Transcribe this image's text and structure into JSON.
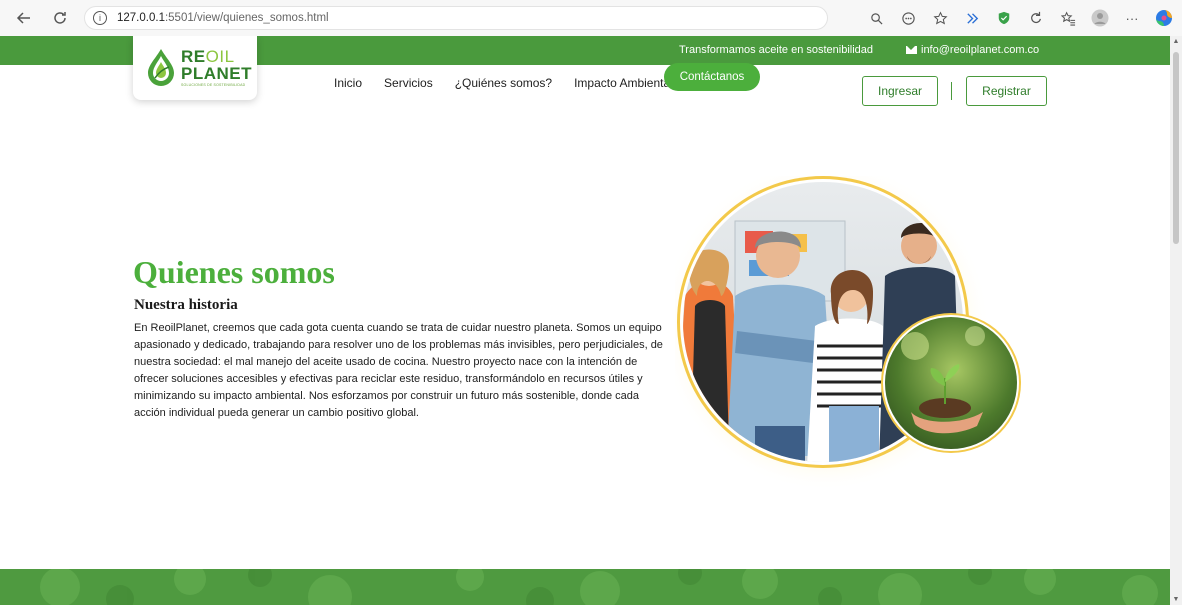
{
  "browser": {
    "url_host": "127.0.0.1",
    "url_path": ":5501/view/quienes_somos.html",
    "icons": [
      "back-icon",
      "reload-icon",
      "info-icon",
      "zoom-icon",
      "reader-icon",
      "favorite-icon",
      "copilot-icon",
      "extension-shield-icon",
      "refresh-extension-icon",
      "favorites-icon",
      "profile-icon",
      "more-icon",
      "edge-icon"
    ]
  },
  "topbar": {
    "tagline": "Transformamos aceite en sostenibilidad",
    "email": "info@reoilplanet.com.co"
  },
  "logo": {
    "word_re": "RE",
    "word_oil": "OIL",
    "word_planet": "PLANET",
    "tagline": "SOLUCIONES DE SOSTENIBILIDAD"
  },
  "nav": {
    "items": [
      "Inicio",
      "Servicios",
      "¿Quiénes somos?",
      "Impacto Ambiental"
    ],
    "cta": "Contáctanos"
  },
  "auth": {
    "login": "Ingresar",
    "register": "Registrar"
  },
  "hero": {
    "title": "Quienes somos",
    "subtitle": "Nuestra historia",
    "text": "En ReoilPlanet, creemos que cada gota cuenta cuando se trata de cuidar nuestro planeta. Somos un equipo apasionado y dedicado, trabajando para resolver uno de los problemas más invisibles, pero perjudiciales, de nuestra sociedad: el mal manejo del aceite usado de cocina. Nuestro proyecto nace con la intención de ofrecer soluciones accesibles y efectivas para reciclar este residuo, transformándolo en recursos útiles y minimizando su impacto ambiental. Nos esforzamos por construir un futuro más sostenible, donde cada acción individual pueda generar un cambio positivo global."
  },
  "colors": {
    "brand_green": "#4a9a3d",
    "cta_green": "#4caf3c",
    "title_green": "#4caf3c",
    "ring_yellow": "#f3c94a"
  }
}
